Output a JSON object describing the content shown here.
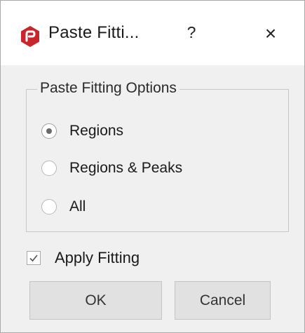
{
  "dialog": {
    "title": "Paste Fitti...",
    "help_label": "?",
    "close_label": "×",
    "icon": "app-logo-icon"
  },
  "options_group": {
    "title": "Paste Fitting Options",
    "options": [
      {
        "label": "Regions",
        "checked": true
      },
      {
        "label": "Regions & Peaks",
        "checked": false
      },
      {
        "label": "All",
        "checked": false
      }
    ]
  },
  "apply_fitting": {
    "label": "Apply Fitting",
    "checked": true
  },
  "buttons": {
    "ok": "OK",
    "cancel": "Cancel"
  },
  "colors": {
    "logo": "#c8262c",
    "dialog_bg": "#f0f0f0",
    "button_bg": "#e1e1e1"
  }
}
